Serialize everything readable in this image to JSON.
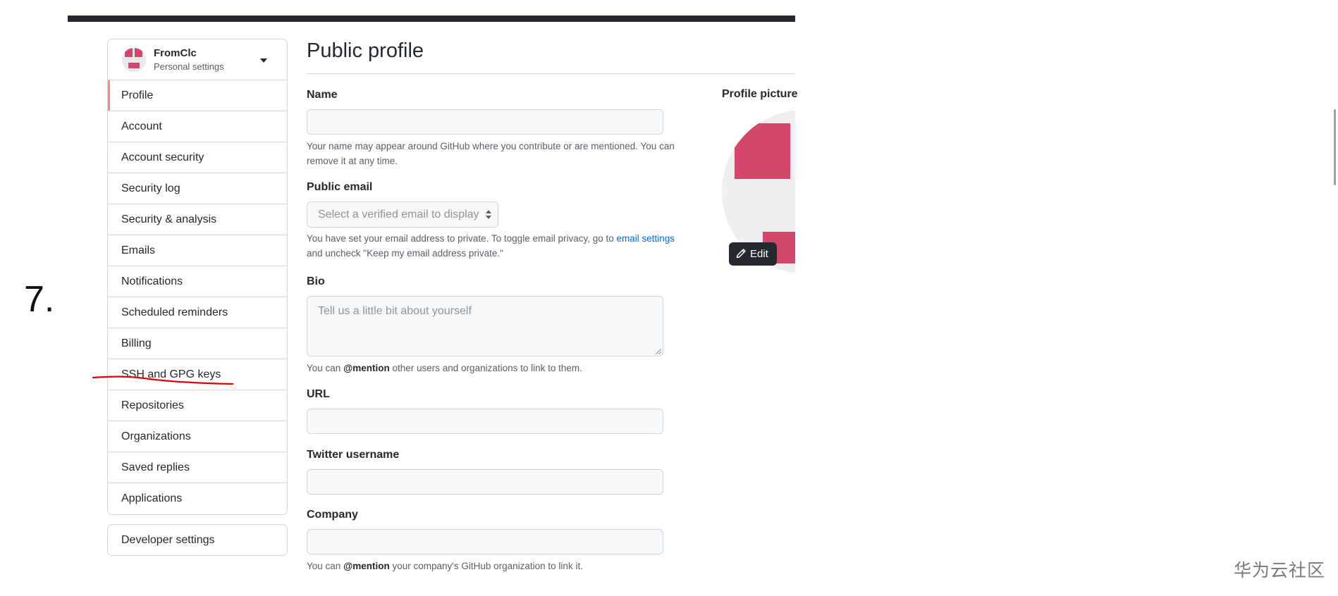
{
  "step_number": "7.",
  "account": {
    "name": "FromClc",
    "subtitle": "Personal settings"
  },
  "sidebar": {
    "items": [
      {
        "label": "Profile",
        "selected": true
      },
      {
        "label": "Account"
      },
      {
        "label": "Account security"
      },
      {
        "label": "Security log"
      },
      {
        "label": "Security & analysis"
      },
      {
        "label": "Emails"
      },
      {
        "label": "Notifications"
      },
      {
        "label": "Scheduled reminders"
      },
      {
        "label": "Billing"
      },
      {
        "label": "SSH and GPG keys",
        "annotated": true
      },
      {
        "label": "Repositories"
      },
      {
        "label": "Organizations"
      },
      {
        "label": "Saved replies"
      },
      {
        "label": "Applications"
      }
    ],
    "developer_settings": "Developer settings"
  },
  "main": {
    "title": "Public profile",
    "name_label": "Name",
    "name_note": "Your name may appear around GitHub where you contribute or are mentioned. You can remove it at any time.",
    "email_label": "Public email",
    "email_placeholder": "Select a verified email to display",
    "email_note_prefix": "You have set your email address to private. To toggle email privacy, go to ",
    "email_note_link": "email settings",
    "email_note_suffix": "and uncheck \"Keep my email address private.\"",
    "bio_label": "Bio",
    "bio_placeholder": "Tell us a little bit about yourself",
    "bio_note_prefix": "You can ",
    "bio_note_mention": "@mention",
    "bio_note_suffix": " other users and organizations to link to them.",
    "url_label": "URL",
    "twitter_label": "Twitter username",
    "company_label": "Company",
    "company_note_prefix": "You can ",
    "company_note_mention": "@mention",
    "company_note_suffix": " your company's GitHub organization to link it."
  },
  "profile_picture": {
    "label": "Profile picture",
    "edit_label": "Edit"
  },
  "colors": {
    "avatar_accent": "#d3486a",
    "selected_indicator": "#fd8c73",
    "annotation": "#e00000",
    "link": "#0969da"
  },
  "watermark": "华为云社区"
}
